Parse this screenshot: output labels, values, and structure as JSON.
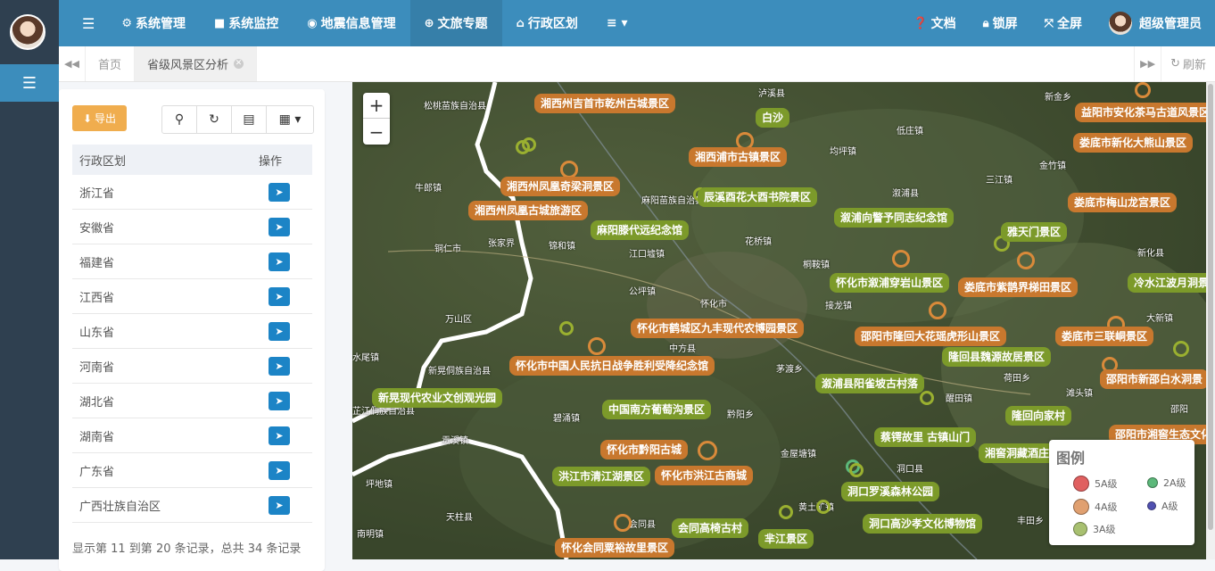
{
  "topbar": {
    "nav": [
      {
        "icon": "gear-icon",
        "glyph": "⚙",
        "label": "系统管理"
      },
      {
        "icon": "video-icon",
        "glyph": "■",
        "label": "系统监控"
      },
      {
        "icon": "map-marker-icon",
        "glyph": "◉",
        "label": "地震信息管理"
      },
      {
        "icon": "globe-icon",
        "glyph": "⊕",
        "label": "文旅专题",
        "active": true
      },
      {
        "icon": "bank-icon",
        "glyph": "⌂",
        "label": "行政区划"
      }
    ],
    "more_glyph": "≡ ▾",
    "right": {
      "docs": "文档",
      "lock": "锁屏",
      "fullscreen": "全屏",
      "user": "超级管理员"
    }
  },
  "tabs": {
    "home": "首页",
    "current": "省级风景区分析",
    "refresh": "刷新"
  },
  "panel": {
    "export_label": "导出",
    "columns": [
      "行政区划",
      "操作"
    ],
    "rows": [
      "浙江省",
      "安徽省",
      "福建省",
      "江西省",
      "山东省",
      "河南省",
      "湖北省",
      "湖南省",
      "广东省",
      "广西壮族自治区"
    ],
    "pager": "显示第 11 到第 20 条记录，总共 34 条记录"
  },
  "map": {
    "legend": {
      "title": "图例",
      "items": [
        {
          "label": "5A级",
          "color": "#e06060"
        },
        {
          "label": "2A级",
          "color": "#5cb87a"
        },
        {
          "label": "4A级",
          "color": "#e0a070"
        },
        {
          "label": "A级",
          "color": "#5050b0"
        },
        {
          "label": "3A级",
          "color": "#a8c070"
        }
      ]
    },
    "labels": [
      {
        "t": "湘西州吉首市乾州古城景区",
        "c": "o"
      },
      {
        "t": "白沙",
        "c": "g"
      },
      {
        "t": "益阳市安化茶马古道风景区",
        "c": "o"
      },
      {
        "t": "湘西浦市古镇景区",
        "c": "o"
      },
      {
        "t": "娄底市新化大熊山景区",
        "c": "o"
      },
      {
        "t": "湘西州凤凰奇梁洞景区",
        "c": "o"
      },
      {
        "t": "辰溪酉花大酉书院景区",
        "c": "g"
      },
      {
        "t": "湘西州凤凰古城旅游区",
        "c": "o"
      },
      {
        "t": "溆浦向警予同志纪念馆",
        "c": "g"
      },
      {
        "t": "娄底市梅山龙宫景区",
        "c": "o"
      },
      {
        "t": "麻阳滕代远纪念馆",
        "c": "g"
      },
      {
        "t": "雅天门景区",
        "c": "g"
      },
      {
        "t": "怀化市溆浦穿岩山景区",
        "c": "g"
      },
      {
        "t": "娄底市紫鹊界梯田景区",
        "c": "o"
      },
      {
        "t": "冷水江波月洞景",
        "c": "g"
      },
      {
        "t": "怀化市鹤城区九丰现代农博园景区",
        "c": "o"
      },
      {
        "t": "邵阳市隆回大花瑶虎形山景区",
        "c": "o"
      },
      {
        "t": "娄底市三联峒景区",
        "c": "o"
      },
      {
        "t": "怀化市中国人民抗日战争胜利受降纪念馆",
        "c": "o"
      },
      {
        "t": "隆回县魏源故居景区",
        "c": "g"
      },
      {
        "t": "邵阳市新邵白水洞景",
        "c": "o"
      },
      {
        "t": "新晃现代农业文创观光园",
        "c": "g"
      },
      {
        "t": "溆浦县阳雀坡古村落",
        "c": "g"
      },
      {
        "t": "中国南方葡萄沟景区",
        "c": "g"
      },
      {
        "t": "隆回向家村",
        "c": "g"
      },
      {
        "t": "邵阳市湘窖生态文化",
        "c": "o"
      },
      {
        "t": "怀化市黔阳古城",
        "c": "o"
      },
      {
        "t": "蔡锷故里 古镇山门",
        "c": "g"
      },
      {
        "t": "湘窖洞藏酒庄",
        "c": "g"
      },
      {
        "t": "洪江市清江湖景区",
        "c": "g"
      },
      {
        "t": "怀化市洪江古商城",
        "c": "o"
      },
      {
        "t": "洞口罗溪森林公园",
        "c": "g"
      },
      {
        "t": "会同高椅古村",
        "c": "g"
      },
      {
        "t": "洞口高沙孝文化博物馆",
        "c": "g"
      },
      {
        "t": "芈江景区",
        "c": "g"
      },
      {
        "t": "怀化会同粟裕故里景区",
        "c": "o"
      }
    ],
    "places": [
      "松桃苗族自治县",
      "泸溪县",
      "新金乡",
      "低庄镇",
      "张家界",
      "均坪镇",
      "牛郎镇",
      "麻阳苗族自治县",
      "溆浦县",
      "三江镇",
      "铜仁市",
      "锦和镇",
      "江口墟镇",
      "花桥镇",
      "桐鞍镇",
      "万山区",
      "公坪镇",
      "怀化市",
      "接龙镇",
      "新晃侗族自治县",
      "芷江侗族自治县",
      "中方县",
      "茅渡乡",
      "水尾镇",
      "碧涌镇",
      "黔阳乡",
      "醒田镇",
      "洞口县",
      "会同县",
      "天柱县",
      "南明镇",
      "坪地镇",
      "贡溪镇",
      "邵阳",
      "金竹镇",
      "新化县",
      "大新镇",
      "荷田乡",
      "滩头镇",
      "黄土矿镇",
      "丰田乡",
      "金屋塘镇"
    ]
  }
}
